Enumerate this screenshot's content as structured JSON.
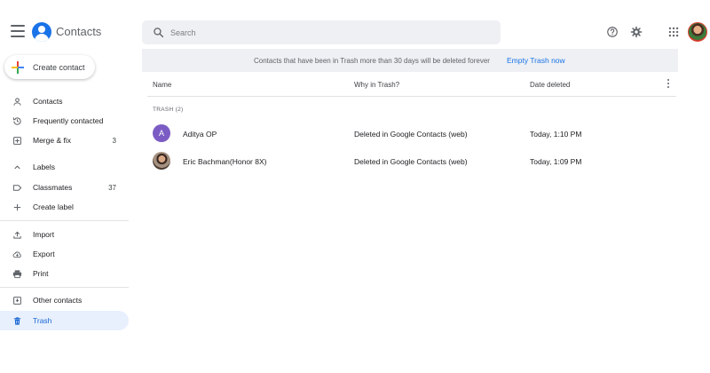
{
  "header": {
    "app_title": "Contacts",
    "search_placeholder": "Search",
    "colors": {
      "brand_blue": "#1a73e8",
      "search_bg": "#eef0f3"
    }
  },
  "sidebar": {
    "create_label": "Create contact",
    "items": [
      {
        "label": "Contacts",
        "icon": "person-icon",
        "count": ""
      },
      {
        "label": "Frequently contacted",
        "icon": "history-icon",
        "count": ""
      },
      {
        "label": "Merge & fix",
        "icon": "merge-icon",
        "count": "3"
      },
      {
        "label": "Labels",
        "icon": "chevron-up-icon",
        "count": ""
      },
      {
        "label": "Classmates",
        "icon": "label-icon",
        "count": "37"
      },
      {
        "label": "Create label",
        "icon": "plus-icon",
        "count": ""
      },
      {
        "label": "Import",
        "icon": "upload-icon",
        "count": ""
      },
      {
        "label": "Export",
        "icon": "cloud-download-icon",
        "count": ""
      },
      {
        "label": "Print",
        "icon": "printer-icon",
        "count": ""
      },
      {
        "label": "Other contacts",
        "icon": "archive-icon",
        "count": ""
      },
      {
        "label": "Trash",
        "icon": "trash-icon",
        "count": ""
      }
    ],
    "active_item": "Trash",
    "active_color": "#e8f0fe"
  },
  "banner": {
    "text": "Contacts that have been in Trash more than 30 days will be deleted forever",
    "action_label": "Empty Trash now"
  },
  "table": {
    "columns": [
      "Name",
      "Why in Trash?",
      "Date deleted"
    ],
    "section_label": "TRASH (2)",
    "rows": [
      {
        "initial": "A",
        "avatar_color": "#7b5cc4",
        "name": "Aditya OP",
        "reason": "Deleted in Google Contacts (web)",
        "date": "Today, 1:10 PM"
      },
      {
        "initial": "",
        "avatar_color": "",
        "name": "Eric Bachman(Honor 8X)",
        "reason": "Deleted in Google Contacts (web)",
        "date": "Today, 1:09 PM"
      }
    ]
  }
}
